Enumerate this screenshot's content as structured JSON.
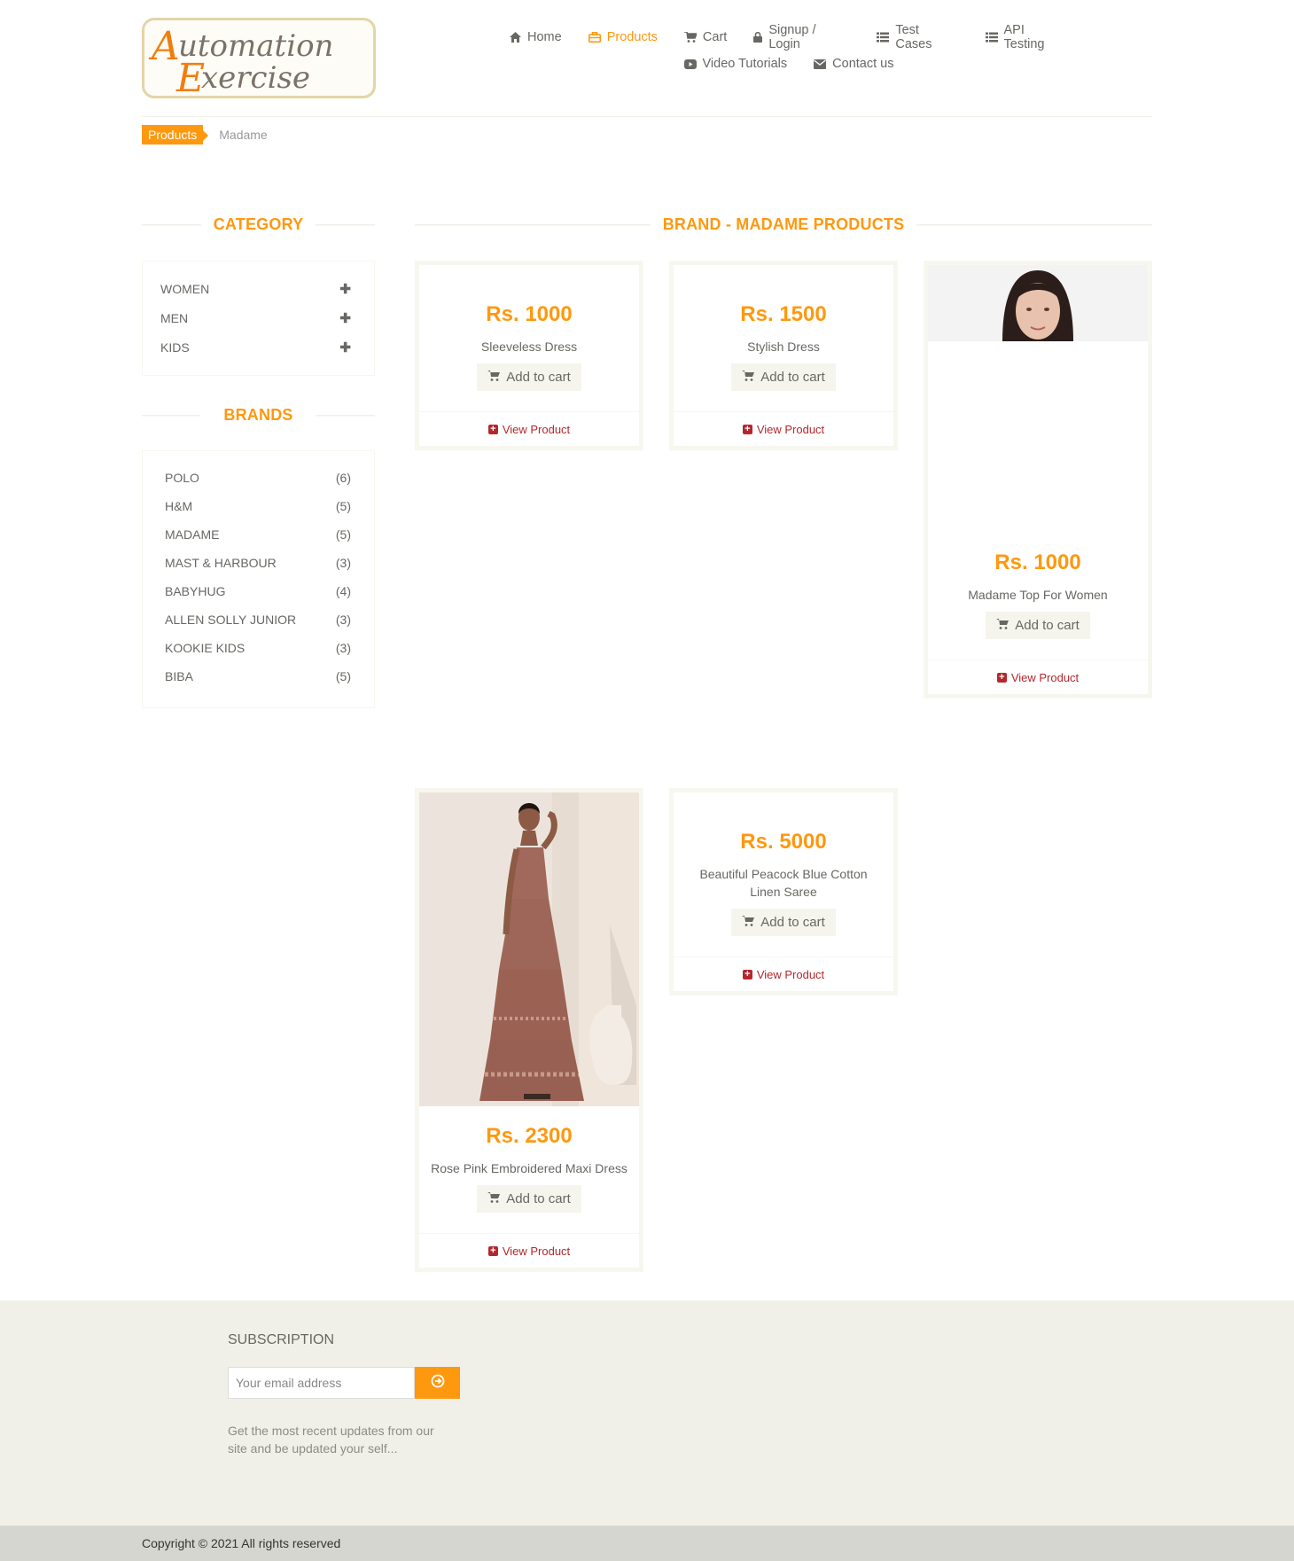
{
  "brand_logo": "Automation Exercise",
  "nav": {
    "row1": [
      {
        "label": "Home",
        "icon": "home-icon"
      },
      {
        "label": "Products",
        "icon": "products-icon",
        "active": true
      },
      {
        "label": "Cart",
        "icon": "cart-icon"
      },
      {
        "label": "Signup / Login",
        "icon": "lock-icon"
      },
      {
        "label": "Test Cases",
        "icon": "list-icon"
      },
      {
        "label": "API Testing",
        "icon": "list-icon"
      }
    ],
    "row2": [
      {
        "label": "Video Tutorials",
        "icon": "youtube-icon"
      },
      {
        "label": "Contact us",
        "icon": "envelope-icon"
      }
    ]
  },
  "breadcrumb": {
    "parent": "Products",
    "current": "Madame"
  },
  "sidebar": {
    "category_title": "CATEGORY",
    "categories": [
      "WOMEN",
      "MEN",
      "KIDS"
    ],
    "brands_title": "BRANDS",
    "brands": [
      {
        "name": "POLO",
        "count": "(6)"
      },
      {
        "name": "H&M",
        "count": "(5)"
      },
      {
        "name": "MADAME",
        "count": "(5)"
      },
      {
        "name": "MAST & HARBOUR",
        "count": "(3)"
      },
      {
        "name": "BABYHUG",
        "count": "(4)"
      },
      {
        "name": "ALLEN SOLLY JUNIOR",
        "count": "(3)"
      },
      {
        "name": "KOOKIE KIDS",
        "count": "(3)"
      },
      {
        "name": "BIBA",
        "count": "(5)"
      }
    ]
  },
  "products_title": "BRAND - MADAME PRODUCTS",
  "products": [
    {
      "price": "Rs. 1000",
      "name": "Sleeveless Dress"
    },
    {
      "price": "Rs. 1500",
      "name": "Stylish Dress"
    },
    {
      "price": "Rs. 1000",
      "name": "Madame Top For Women"
    },
    {
      "price": "Rs. 2300",
      "name": "Rose Pink Embroidered Maxi Dress"
    },
    {
      "price": "Rs. 5000",
      "name": "Beautiful Peacock Blue Cotton Linen Saree"
    }
  ],
  "labels": {
    "add_to_cart": "Add to cart",
    "view_product": "View Product"
  },
  "footer": {
    "subscription_title": "SUBSCRIPTION",
    "email_placeholder": "Your email address",
    "subscription_text": "Get the most recent updates from our site and be updated your self...",
    "copyright": "Copyright © 2021 All rights reserved"
  },
  "colors": {
    "accent": "#FE980F",
    "view_link": "#B4272D",
    "footer_bg": "#F0F0E9"
  }
}
